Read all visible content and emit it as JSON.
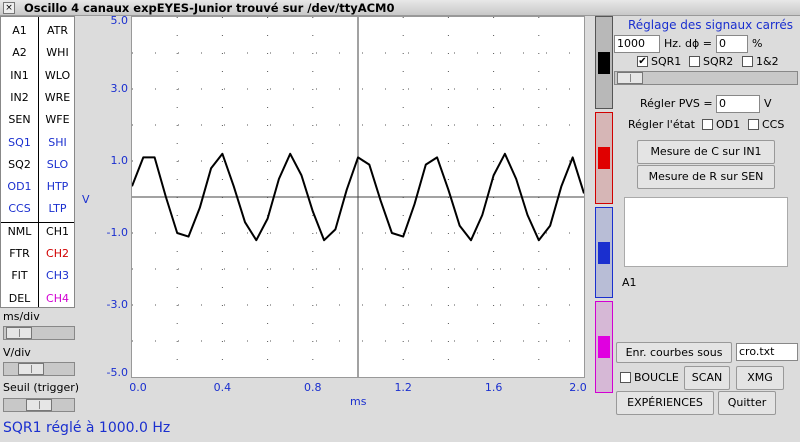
{
  "window": {
    "title": "Oscillo 4 canaux expEYES-Junior trouvé sur /dev/ttyACM0",
    "close_glyph": "×"
  },
  "left_panel": {
    "commands_left": [
      "A1",
      "A2",
      "IN1",
      "IN2",
      "SEN",
      "SQ1",
      "SQ2",
      "OD1",
      "CCS",
      "NML",
      "FTR",
      "FIT",
      "DEL"
    ],
    "commands_right": [
      "ATR",
      "WHI",
      "WLO",
      "WRE",
      "WFE",
      "SHI",
      "SLO",
      "HTP",
      "LTP",
      "CH1",
      "CH2",
      "CH3",
      "CH4"
    ],
    "timebase_label": "ms/div",
    "vdiv_label": "V/div",
    "trigger_label": "Seuil (trigger)"
  },
  "plot": {
    "ylabel": "V",
    "xlabel": "ms",
    "trace_color": "#000000"
  },
  "chart_data": {
    "type": "line",
    "title": "",
    "xlabel": "ms",
    "ylabel": "V",
    "xlim": [
      0.0,
      2.0
    ],
    "ylim": [
      -5.0,
      5.0
    ],
    "x_ticks": [
      "0.0",
      "0.4",
      "0.8",
      "1.2",
      "1.6",
      "2.0"
    ],
    "y_ticks": [
      "5.0",
      "3.0",
      "1.0",
      "-1.0",
      "-3.0",
      "-5.0"
    ],
    "grid": true,
    "series": [
      {
        "x": [
          0.0,
          0.05,
          0.1,
          0.15,
          0.2,
          0.25,
          0.3,
          0.35,
          0.4,
          0.45,
          0.5,
          0.55,
          0.6,
          0.65,
          0.7,
          0.75,
          0.8,
          0.85,
          0.9,
          0.95,
          1.0,
          1.05,
          1.1,
          1.15,
          1.2,
          1.25,
          1.3,
          1.35,
          1.4,
          1.45,
          1.5,
          1.55,
          1.6,
          1.65,
          1.7,
          1.75,
          1.8,
          1.85,
          1.9,
          1.95,
          2.0
        ],
        "values": [
          0.3,
          1.1,
          1.1,
          0.0,
          -1.0,
          -1.1,
          -0.3,
          0.8,
          1.2,
          0.3,
          -0.7,
          -1.2,
          -0.6,
          0.5,
          1.2,
          0.6,
          -0.4,
          -1.2,
          -0.9,
          0.2,
          1.1,
          0.9,
          -0.1,
          -1.0,
          -1.1,
          -0.2,
          0.9,
          1.1,
          0.2,
          -0.8,
          -1.2,
          -0.5,
          0.6,
          1.2,
          0.5,
          -0.5,
          -1.2,
          -0.8,
          0.3,
          1.1,
          0.1
        ]
      }
    ]
  },
  "right_panel": {
    "square_title": "Réglage des signaux carrés",
    "freq_value": "1000",
    "freq_unit": "Hz. dϕ =",
    "phase_value": "0",
    "phase_unit": "%",
    "check_sqr1": "SQR1",
    "check_sqr2": "SQR2",
    "check_12": "1&2",
    "pvs_label": "Régler PVS =",
    "pvs_value": "0",
    "pvs_unit": "V",
    "state_label": "Régler l'état",
    "check_od1": "OD1",
    "check_ccs": "CCS",
    "measure_c": "Mesure de C sur IN1",
    "measure_r": "Mesure de R sur SEN",
    "channel_label": "A1",
    "save_button": "Enr. courbes sous",
    "save_filename": "cro.txt",
    "check_loop": "BOUCLE",
    "scan_button": "SCAN",
    "xmg_button": "XMG",
    "experiences_button": "EXPÉRIENCES",
    "quit_button": "Quitter",
    "check_mark": "✔"
  },
  "status": {
    "text": "SQR1 réglé à 1000.0 Hz"
  }
}
